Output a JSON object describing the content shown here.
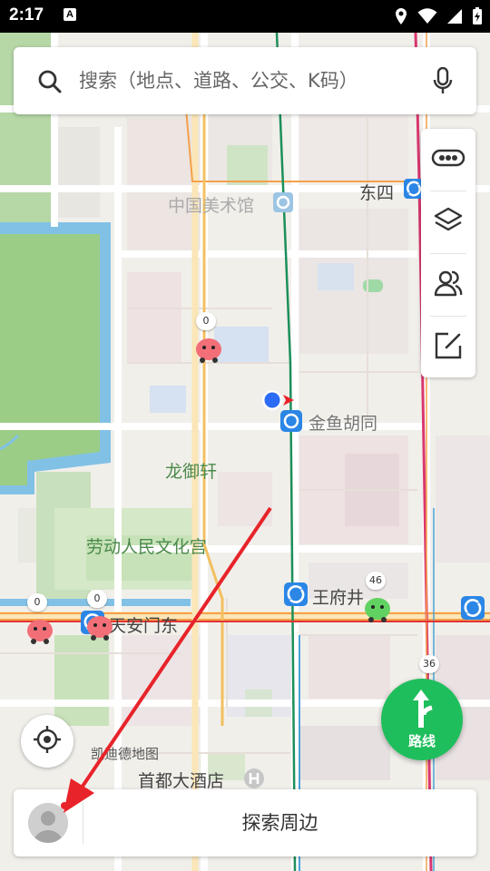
{
  "status_bar": {
    "time": "2:17",
    "notification": "A"
  },
  "search": {
    "placeholder": "搜索（地点、道路、公交、K码）"
  },
  "map": {
    "labels": {
      "museum": "中国美术馆",
      "dongsi": "东四",
      "jinyu": "金鱼胡同",
      "longyu": "龙御轩",
      "laodong": "劳动人民文化宫",
      "wangfujing": "王府井",
      "tiananmen": "天安门东",
      "kaide": "凯迪德地图",
      "hotel": "首都大酒店"
    },
    "pins": [
      {
        "count": "0",
        "color": "#f26f78"
      },
      {
        "count": "0",
        "color": "#f26f78"
      },
      {
        "count": "0",
        "color": "#f26f78"
      },
      {
        "count": "46",
        "color": "#61d261"
      }
    ],
    "road_badge": "36"
  },
  "route_button": {
    "label": "路线"
  },
  "bottom_bar": {
    "explore_label": "探索周边"
  },
  "colors": {
    "route_green": "#1fbe5c",
    "subway_blue": "#2b86e6",
    "location_blue": "#2b6bf5"
  }
}
